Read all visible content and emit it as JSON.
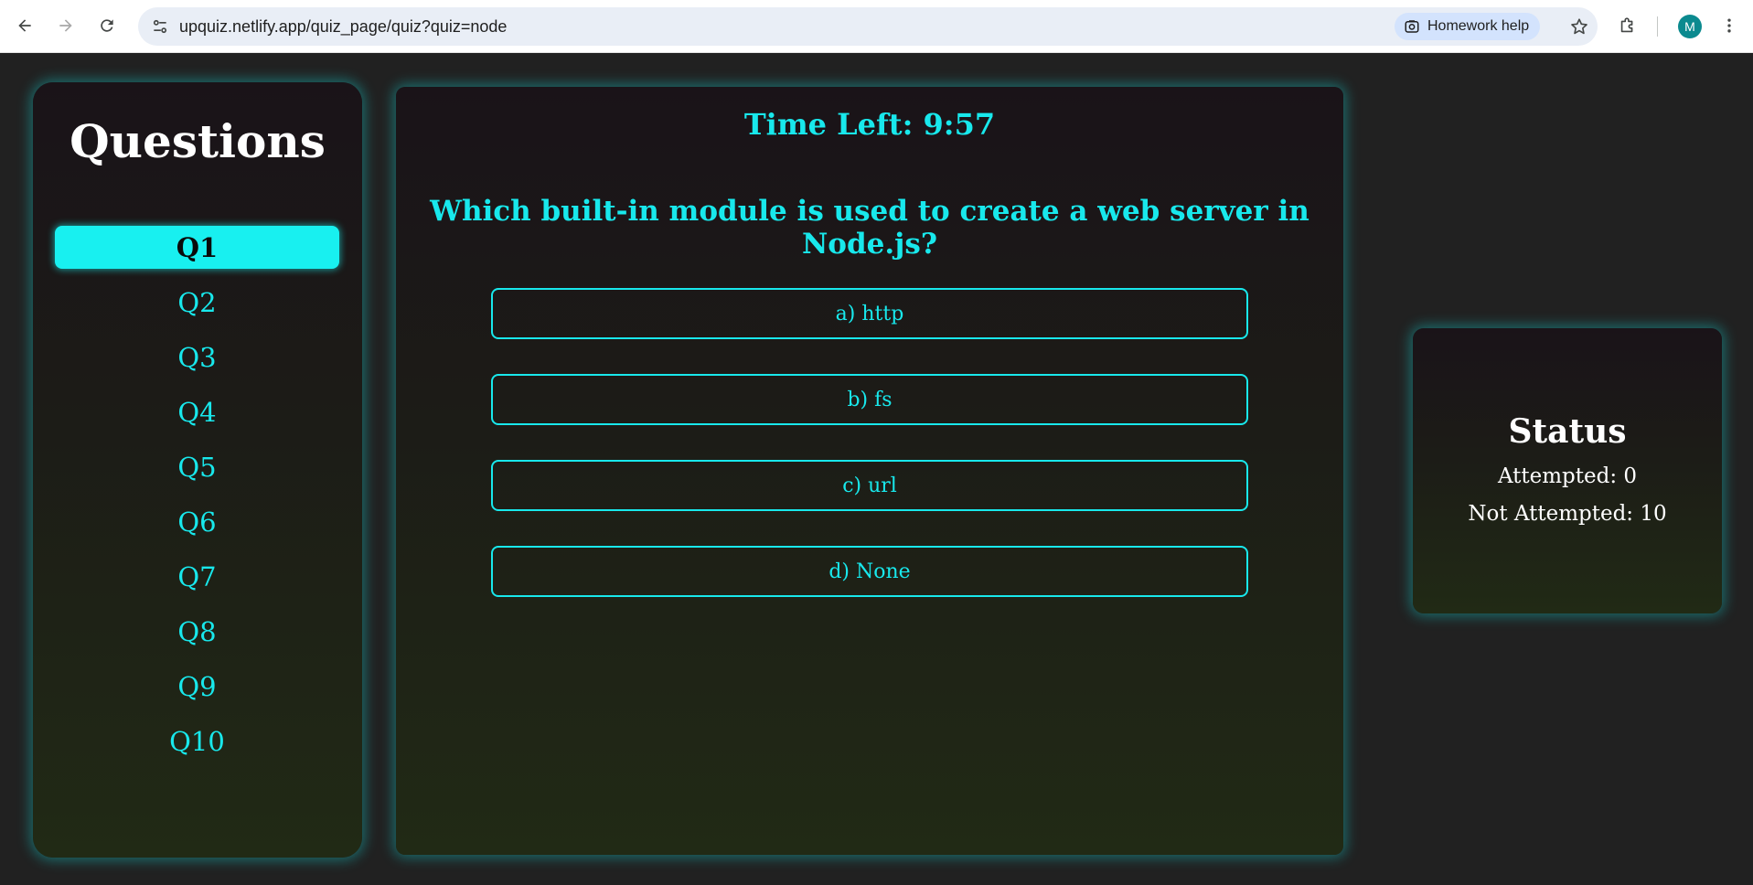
{
  "browser": {
    "url": "upquiz.netlify.app/quiz_page/quiz?quiz=node",
    "homework_help_label": "Homework help",
    "profile_initial": "M"
  },
  "sidebar": {
    "title": "Questions",
    "items": [
      {
        "label": "Q1",
        "active": true
      },
      {
        "label": "Q2"
      },
      {
        "label": "Q3"
      },
      {
        "label": "Q4"
      },
      {
        "label": "Q5"
      },
      {
        "label": "Q6"
      },
      {
        "label": "Q7"
      },
      {
        "label": "Q8"
      },
      {
        "label": "Q9"
      },
      {
        "label": "Q10"
      }
    ]
  },
  "quiz": {
    "timer": "Time Left: 9:57",
    "question": "Which built-in module is used to create a web server in Node.js?",
    "options": [
      "a) http",
      "b) fs",
      "c) url",
      "d) None"
    ]
  },
  "status": {
    "title": "Status",
    "attempted": "Attempted: 0",
    "not_attempted": "Not Attempted: 10"
  },
  "colors": {
    "accent": "#18e8ec",
    "page_background": "#212121"
  }
}
